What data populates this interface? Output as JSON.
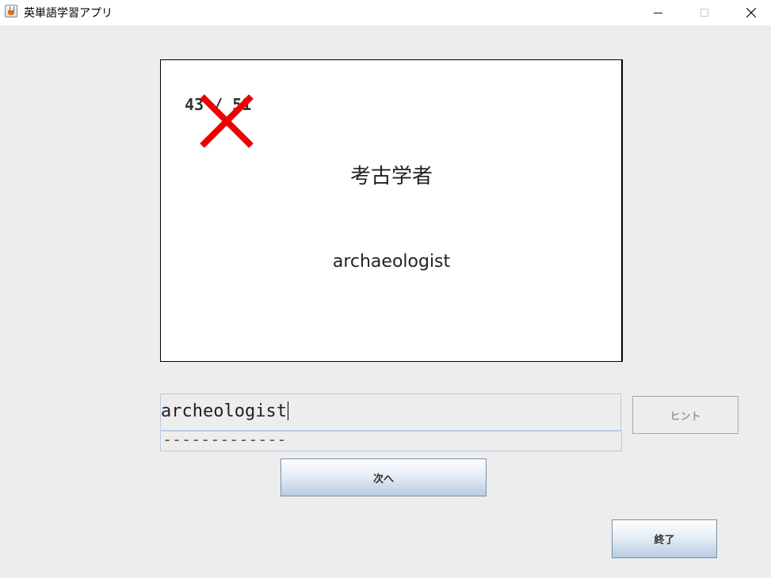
{
  "window": {
    "title": "英単語学習アプリ",
    "icon": "java-cup-icon",
    "controls": [
      "minimize-icon",
      "maximize-icon",
      "close-icon"
    ]
  },
  "card": {
    "progress": "43 / 51",
    "result_mark": "incorrect-x-icon",
    "result_color": "#ee0000",
    "japanese": "考古学者",
    "english": "archaeologist"
  },
  "answer": {
    "value": "archeologist"
  },
  "hint": {
    "text": "-------------",
    "button_label": "ヒント",
    "button_enabled": false
  },
  "buttons": {
    "next_label": "次へ",
    "quit_label": "終了"
  }
}
